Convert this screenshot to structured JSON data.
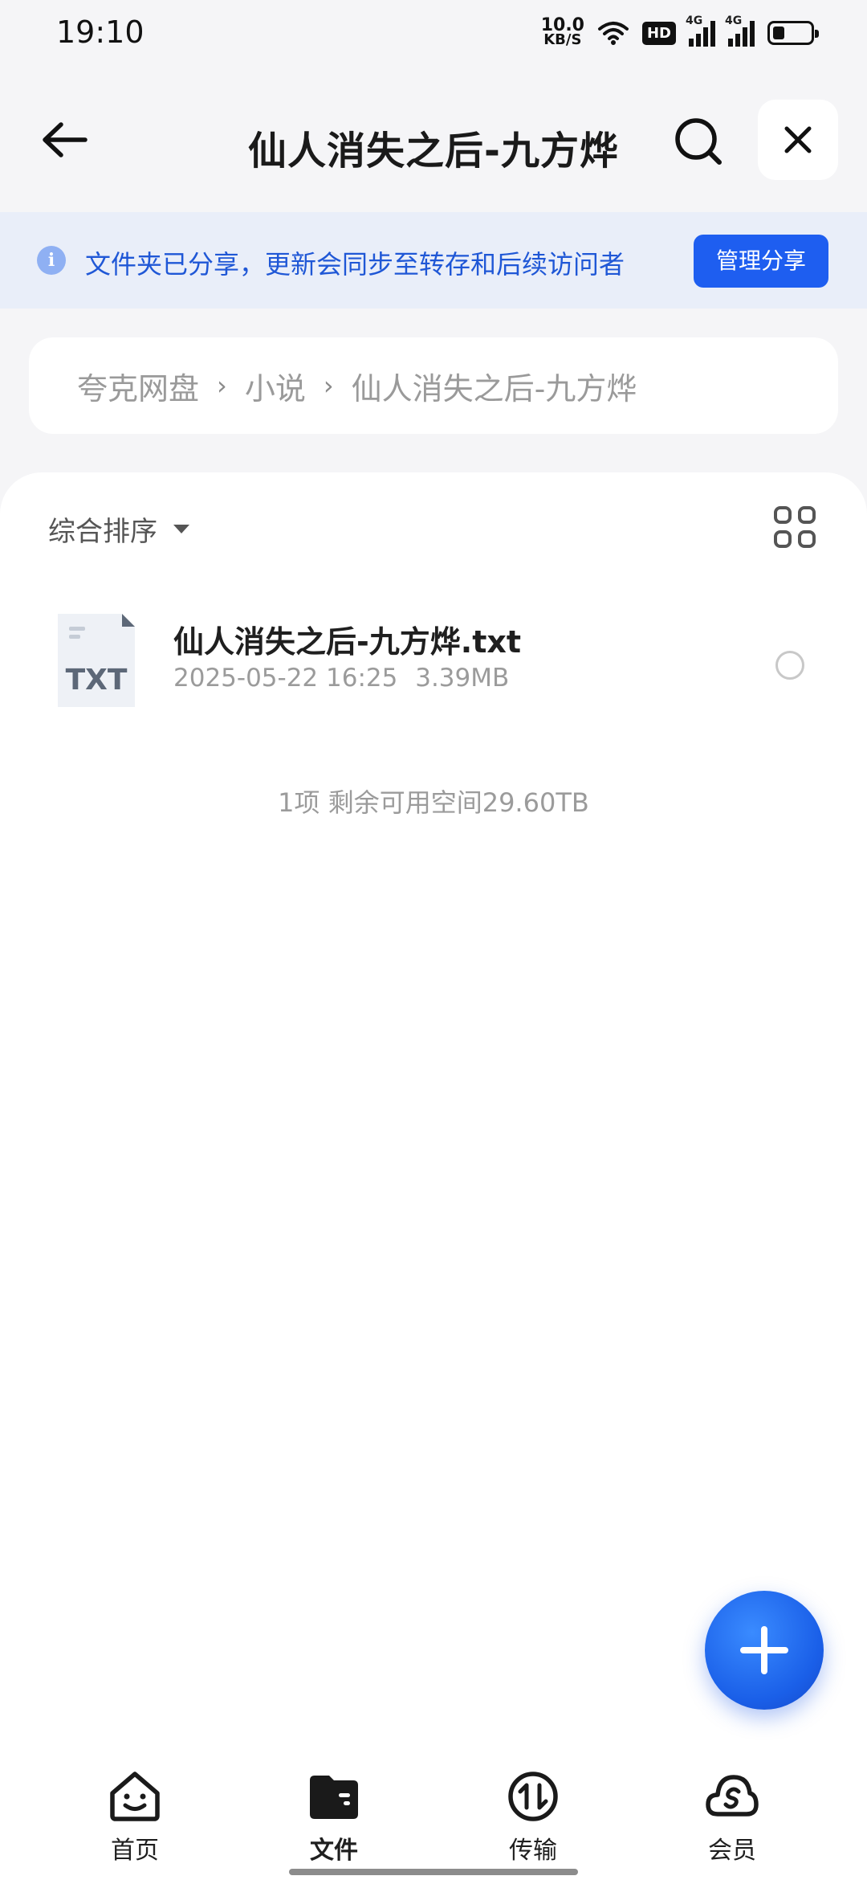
{
  "status_bar": {
    "time": "19:10",
    "net_speed_value": "10.0",
    "net_speed_unit": "KB/S",
    "hd_badge": "HD",
    "signal1_label": "4G",
    "signal2_label": "4G",
    "battery_level": 0.25
  },
  "header": {
    "title": "仙人消失之后-九方烨",
    "back_icon": "arrow-left-icon",
    "search_icon": "search-icon",
    "close_icon": "close-icon"
  },
  "share_banner": {
    "text": "文件夹已分享，更新会同步至转存和后续访问者",
    "button_label": "管理分享",
    "info_icon_glyph": "i"
  },
  "breadcrumb": {
    "items": [
      "夸克网盘",
      "小说",
      "仙人消失之后-九方烨"
    ],
    "separator": "›"
  },
  "file_list": {
    "sort_label": "综合排序",
    "files": [
      {
        "name": "仙人消失之后-九方烨.txt",
        "date": "2025-05-22 16:25",
        "size": "3.39MB",
        "type_label": "TXT"
      }
    ],
    "footer": "1项 剩余可用空间29.60TB"
  },
  "tabs": [
    {
      "label": "首页",
      "icon": "home-face-icon",
      "active": false
    },
    {
      "label": "文件",
      "icon": "folder-icon",
      "active": true
    },
    {
      "label": "传输",
      "icon": "transfer-icon",
      "active": false
    },
    {
      "label": "会员",
      "icon": "vip-cloud-icon",
      "active": false
    }
  ],
  "colors": {
    "accent": "#1e5ef0",
    "banner_bg": "#e9eef9",
    "banner_text": "#1f57d6"
  }
}
